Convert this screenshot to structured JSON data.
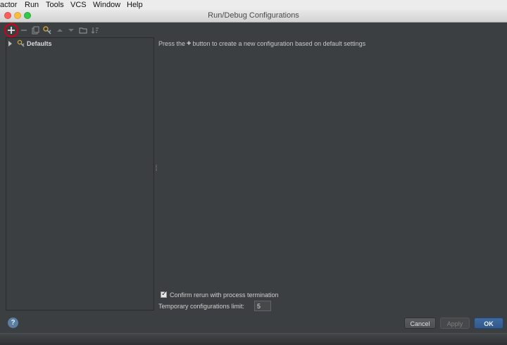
{
  "menubar": {
    "items": [
      "actor",
      "Run",
      "Tools",
      "VCS",
      "Window",
      "Help"
    ]
  },
  "window": {
    "title": "Run/Debug Configurations"
  },
  "toolbar": {
    "icons": [
      "add-icon",
      "remove-icon",
      "copy-icon",
      "edit-defaults-icon",
      "move-up-icon",
      "move-down-icon",
      "folder-icon",
      "sort-icon"
    ]
  },
  "tree": {
    "items": [
      {
        "label": "Defaults"
      }
    ]
  },
  "content": {
    "hint_before": "Press the",
    "hint_plus": "+",
    "hint_after": "button to create a new configuration based on default settings",
    "confirm_label": "Confirm rerun with process termination",
    "confirm_checked": true,
    "limit_label": "Temporary configurations limit:",
    "limit_value": "5"
  },
  "buttons": {
    "help": "?",
    "cancel": "Cancel",
    "apply": "Apply",
    "ok": "OK"
  },
  "colors": {
    "background": "#3c3f41",
    "highlight": "#d0021b",
    "ok_button": "#365880"
  }
}
